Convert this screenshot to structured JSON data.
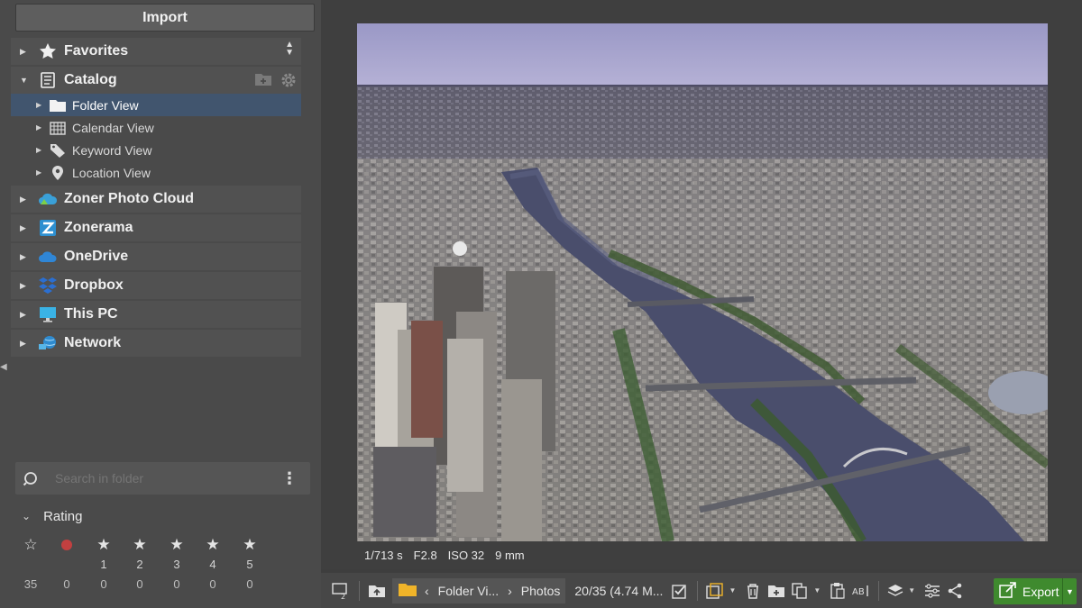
{
  "sidebar": {
    "import_label": "Import",
    "tree": {
      "favorites": "Favorites",
      "catalog": "Catalog",
      "catalog_children": [
        "Folder View",
        "Calendar View",
        "Keyword View",
        "Location View"
      ],
      "zoner_cloud": "Zoner Photo Cloud",
      "zonerama": "Zonerama",
      "onedrive": "OneDrive",
      "dropbox": "Dropbox",
      "this_pc": "This PC",
      "network": "Network"
    },
    "search": {
      "placeholder": "Search in folder"
    },
    "rating": {
      "title": "Rating",
      "levels": [
        "",
        "",
        "1",
        "2",
        "3",
        "4",
        "5"
      ],
      "counts": [
        "35",
        "0",
        "0",
        "0",
        "0",
        "0",
        "0"
      ]
    }
  },
  "viewer": {
    "exif": {
      "shutter": "1/713 s",
      "aperture": "F2.8",
      "iso": "ISO 32",
      "focal": "9 mm"
    }
  },
  "toolbar": {
    "breadcrumb": [
      "Folder Vi...",
      "Photos"
    ],
    "count": "20/35 (4.74 M...",
    "export_label": "Export"
  },
  "colors": {
    "selection": "#41556e",
    "export": "#3f8a2e",
    "reject": "#c24040"
  }
}
